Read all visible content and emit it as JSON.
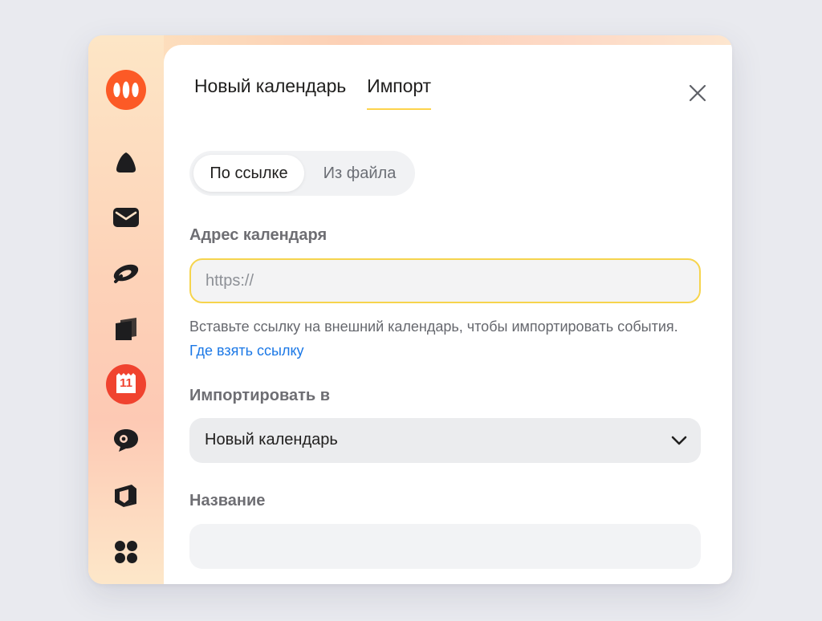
{
  "colors": {
    "accent_yellow": "#fdd34c",
    "link_blue": "#1b78e6",
    "brand_orange": "#fc5a26",
    "calendar_red": "#f0432f"
  },
  "sidebar": {
    "items": [
      {
        "icon": "yandex-360-logo-icon"
      },
      {
        "icon": "cloud-drop-icon"
      },
      {
        "icon": "mail-icon"
      },
      {
        "icon": "telemost-icon"
      },
      {
        "icon": "disk-icon"
      },
      {
        "icon": "calendar-icon",
        "badge": "11"
      },
      {
        "icon": "messenger-icon"
      },
      {
        "icon": "notes-icon"
      },
      {
        "icon": "all-services-icon"
      }
    ]
  },
  "dialog": {
    "tabs": [
      {
        "label": "Новый календарь",
        "active": false
      },
      {
        "label": "Импорт",
        "active": true
      }
    ],
    "source_switch": {
      "options": [
        {
          "label": "По ссылке",
          "active": true
        },
        {
          "label": "Из файла",
          "active": false
        }
      ]
    },
    "address": {
      "label": "Адрес календаря",
      "value": "",
      "placeholder": "https://"
    },
    "hint": {
      "text": "Вставьте ссылку на внешний календарь, чтобы импортировать события.",
      "link": "Где взять ссылку"
    },
    "import_to": {
      "label": "Импортировать в",
      "selected": "Новый календарь"
    },
    "name": {
      "label": "Название",
      "value": "",
      "placeholder": ""
    }
  }
}
